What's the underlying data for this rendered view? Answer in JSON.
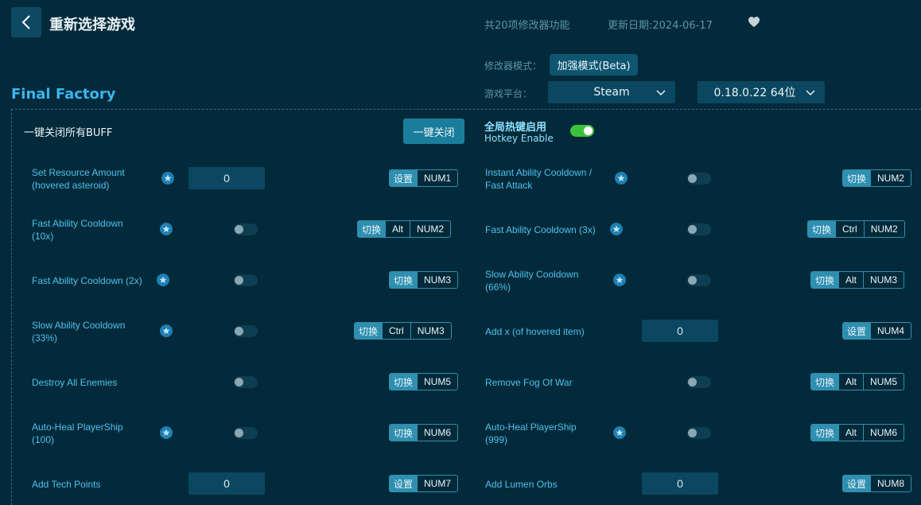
{
  "header": {
    "title": "重新选择游戏",
    "feature_count": "共20项修改器功能",
    "update_date": "更新日期:2024-06-17",
    "mode_label": "修改器模式：",
    "mode_value": "加强模式(Beta)",
    "platform_label": "游戏平台：",
    "platform_value": "Steam",
    "version_value": "0.18.0.22 64位"
  },
  "game": {
    "title": "Final Factory"
  },
  "panel": {
    "buff_label": "一键关闭所有BUFF",
    "close_all": "一键关闭",
    "hotkey_title": "全局热键启用",
    "hotkey_sub": "Hotkey Enable"
  },
  "options": [
    {
      "line1": "Set Resource Amount",
      "line2": "(hovered asteroid)",
      "input": "0",
      "action": "设置",
      "keys": [
        "NUM1"
      ]
    },
    {
      "line1": "Instant Ability Cooldown /",
      "line2": "Fast Attack",
      "action": "切换",
      "keys": [
        "NUM2"
      ]
    },
    {
      "line1": "Fast Ability Cooldown",
      "line2": "(10x)",
      "action": "切换",
      "keys": [
        "Alt",
        "NUM2"
      ]
    },
    {
      "line1": "Fast Ability Cooldown (3x)",
      "line2": "",
      "action": "切换",
      "keys": [
        "Ctrl",
        "NUM2"
      ]
    },
    {
      "line1": "Fast Ability Cooldown (2x)",
      "line2": "",
      "action": "切换",
      "keys": [
        "NUM3"
      ]
    },
    {
      "line1": "Slow Ability Cooldown",
      "line2": "(66%)",
      "action": "切换",
      "keys": [
        "Alt",
        "NUM3"
      ]
    },
    {
      "line1": "Slow Ability Cooldown",
      "line2": "(33%)",
      "action": "切换",
      "keys": [
        "Ctrl",
        "NUM3"
      ]
    },
    {
      "line1": "Add x (of hovered item)",
      "line2": "",
      "input": "0",
      "action": "设置",
      "keys": [
        "NUM4"
      ]
    },
    {
      "line1": "Destroy All Enemies",
      "line2": "",
      "action": "切换",
      "keys": [
        "NUM5"
      ]
    },
    {
      "line1": "Remove Fog Of War",
      "line2": "",
      "action": "切换",
      "keys": [
        "Alt",
        "NUM5"
      ]
    },
    {
      "line1": "Auto-Heal PlayerShip",
      "line2": "(100)",
      "action": "切换",
      "keys": [
        "NUM6"
      ]
    },
    {
      "line1": "Auto-Heal PlayerShip",
      "line2": "(999)",
      "action": "切换",
      "keys": [
        "Alt",
        "NUM6"
      ]
    },
    {
      "line1": "Add Tech Points",
      "line2": "",
      "input": "0",
      "action": "设置",
      "keys": [
        "NUM7"
      ]
    },
    {
      "line1": "Add Lumen Orbs",
      "line2": "",
      "input": "0",
      "action": "设置",
      "keys": [
        "NUM8"
      ]
    }
  ]
}
